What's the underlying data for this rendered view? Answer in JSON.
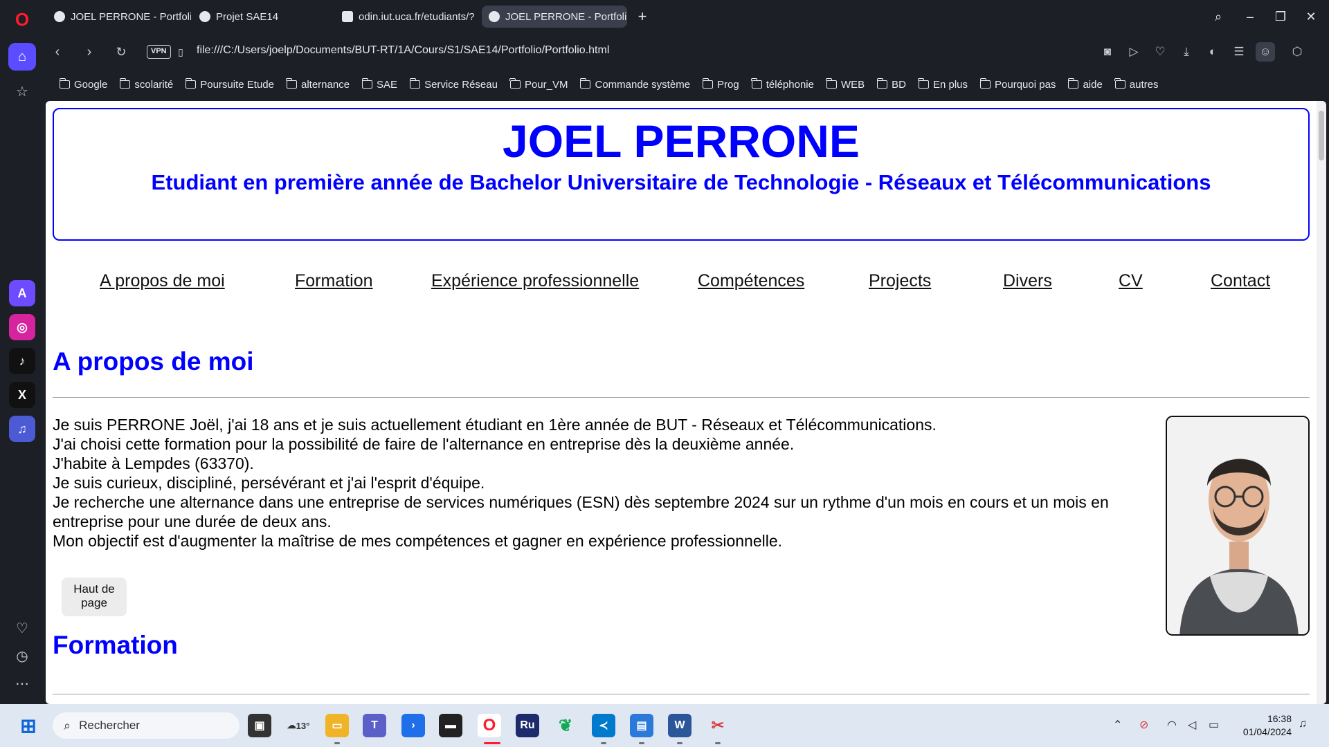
{
  "browser": {
    "tabs": [
      {
        "title": "JOEL PERRONE - Portfolio",
        "active": false
      },
      {
        "title": "Projet SAE14",
        "active": false
      },
      {
        "title": "odin.iut.uca.fr/etudiants/?",
        "active": false
      },
      {
        "title": "JOEL PERRONE - Portfolio",
        "active": true
      }
    ],
    "vpn_label": "VPN",
    "url": "file:///C:/Users/joelp/Documents/BUT-RT/1A/Cours/S1/SAE14/Portfolio/Portfolio.html",
    "bookmarks": [
      "Google",
      "scolarité",
      "Poursuite Etude",
      "alternance",
      "SAE",
      "Service Réseau",
      "Pour_VM",
      "Commande système",
      "Prog",
      "téléphonie",
      "WEB",
      "BD",
      "En plus",
      "Pourquoi pas",
      "aide",
      "autres"
    ]
  },
  "page": {
    "name": "JOEL PERRONE",
    "subtitle": "Etudiant en première année de Bachelor Universitaire de Technologie - Réseaux et Télécommunications",
    "nav": [
      "A propos de moi",
      "Formation",
      "Expérience professionnelle",
      "Compétences",
      "Projects",
      "Divers",
      "CV",
      "Contact"
    ],
    "about": {
      "title": "A propos de moi",
      "lines": [
        "Je suis PERRONE Joël, j'ai 18 ans et je suis actuellement étudiant en 1ère année de BUT - Réseaux et Télécommunications.",
        "J'ai choisi cette formation pour la possibilité de faire de l'alternance en entreprise dès la deuxième année.",
        "J'habite à Lempdes (63370).",
        "Je suis curieux, discipliné, persévérant et j'ai l'esprit d'équipe.",
        "Je recherche une alternance dans une entreprise de services numériques (ESN) dès septembre 2024 sur un rythme d'un mois en cours et un mois en entreprise pour une durée de deux ans.",
        "Mon objectif est d'augmenter la maîtrise de mes compétences et gagner en expérience professionnelle."
      ],
      "top_button": "Haut de page"
    },
    "formation": {
      "title": "Formation"
    }
  },
  "taskbar": {
    "search_placeholder": "Rechercher",
    "weather": "13°",
    "time": "16:38",
    "date": "01/04/2024"
  },
  "colors": {
    "accent": "#0000ff",
    "browser_bg": "#1c1f26",
    "taskbar_bg": "#dfe7f3"
  }
}
